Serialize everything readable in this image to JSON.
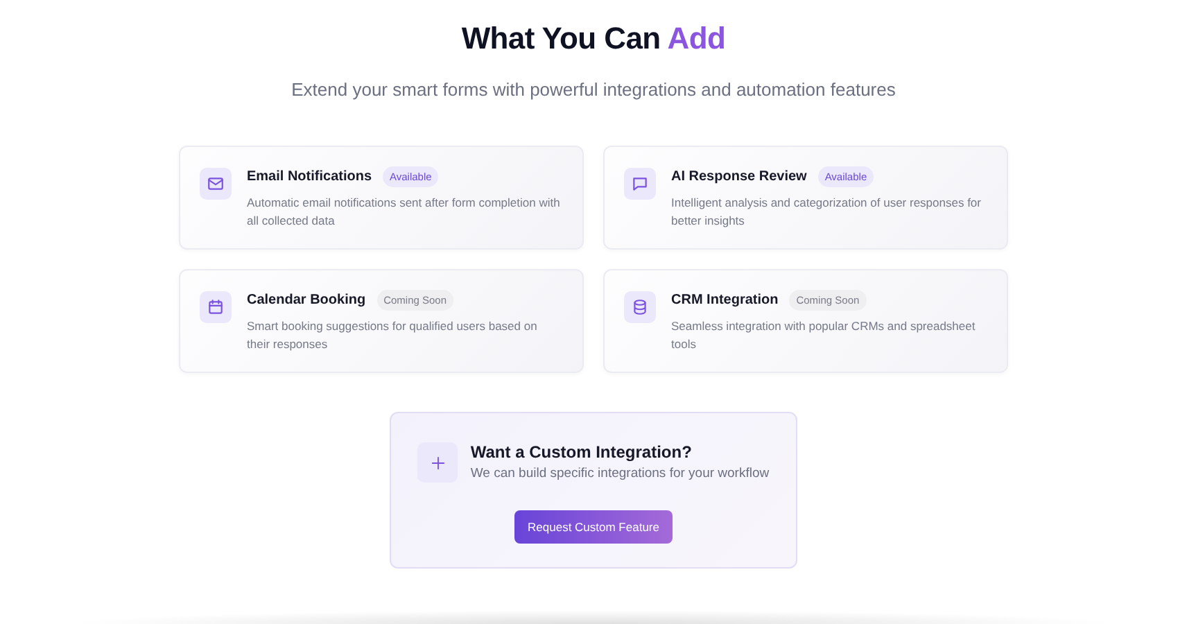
{
  "heading": {
    "title": "What You Can",
    "accent": "Add"
  },
  "subtitle": "Extend your smart forms with powerful integrations and automation features",
  "features": [
    {
      "title": "Email Notifications",
      "status": {
        "kind": "available",
        "label": "Available"
      },
      "description": "Automatic email notifications sent after form completion with all collected data"
    },
    {
      "title": "AI Response Review",
      "status": {
        "kind": "available",
        "label": "Available"
      },
      "description": "Intelligent analysis and categorization of user responses for better insights"
    },
    {
      "title": "Calendar Booking",
      "status": {
        "kind": "coming_soon",
        "label": "Coming Soon"
      },
      "description": "Smart booking suggestions for qualified users based on their responses"
    },
    {
      "title": "CRM Integration",
      "status": {
        "kind": "coming_soon",
        "label": "Coming Soon"
      },
      "description": "Seamless integration with popular CRMs and spreadsheet tools"
    }
  ],
  "custom": {
    "title": "Want a Custom Integration?",
    "description": "We can build specific integrations for your workflow",
    "button": "Request Custom Feature"
  }
}
